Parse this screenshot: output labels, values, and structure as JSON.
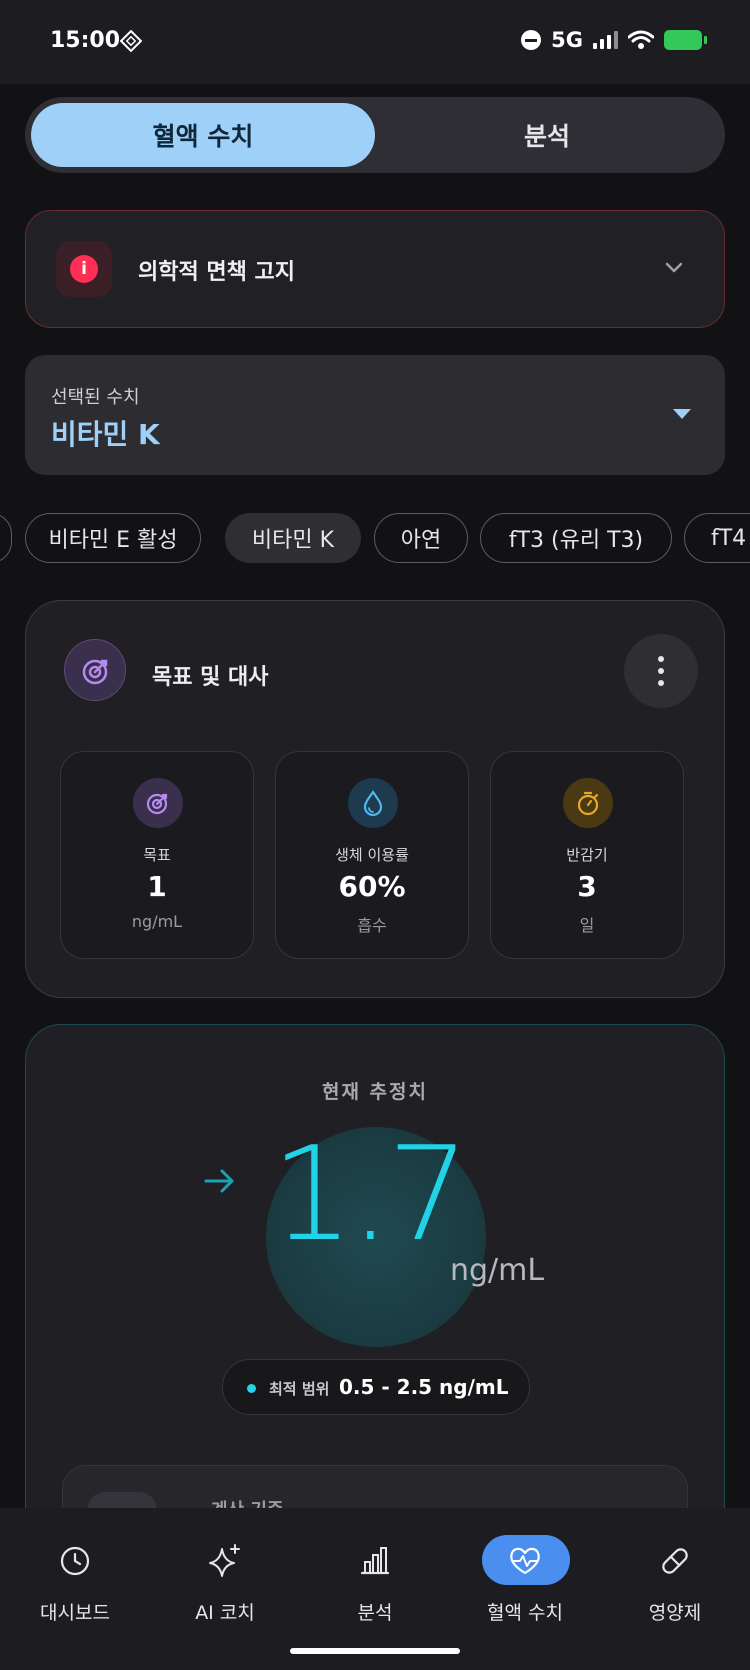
{
  "status_bar": {
    "time": "15:00",
    "network": "5G"
  },
  "tabs": [
    {
      "label": "혈액 수치",
      "active": true
    },
    {
      "label": "분석",
      "active": false
    }
  ],
  "disclaimer": {
    "title": "의학적 면책 고지",
    "icon": "info-icon"
  },
  "selected_metric": {
    "label": "선택된 수치",
    "value": "비타민 K"
  },
  "chips": [
    "비타민 E 활성",
    "비타민 K",
    "아연",
    "fT3 (유리 T3)",
    "fT4"
  ],
  "goal_card": {
    "title": "목표 및 대사",
    "stats": [
      {
        "label": "목표",
        "value": "1",
        "sub": "ng/mL",
        "icon": "target-icon",
        "color": "#b48cf0"
      },
      {
        "label": "생체 이용률",
        "value": "60%",
        "sub": "흡수",
        "icon": "droplet-icon",
        "color": "#4fb8f0"
      },
      {
        "label": "반감기",
        "value": "3",
        "sub": "일",
        "icon": "stopwatch-icon",
        "color": "#e6a72a"
      }
    ]
  },
  "estimate": {
    "title": "현재 추정치",
    "value": "1.7",
    "unit": "ng/mL",
    "range_label": "최적 범위",
    "range_value": "0.5 - 2.5 ng/mL",
    "calc_title": "계산 기준",
    "accent": "#22d3e8"
  },
  "bottom_nav": [
    {
      "label": "대시보드",
      "icon": "clock-icon",
      "active": false
    },
    {
      "label": "AI 코치",
      "icon": "sparkle-icon",
      "active": false
    },
    {
      "label": "분석",
      "icon": "bar-chart-icon",
      "active": false
    },
    {
      "label": "혈액 수치",
      "icon": "heart-pulse-icon",
      "active": true
    },
    {
      "label": "영양제",
      "icon": "pill-icon",
      "active": false
    }
  ]
}
